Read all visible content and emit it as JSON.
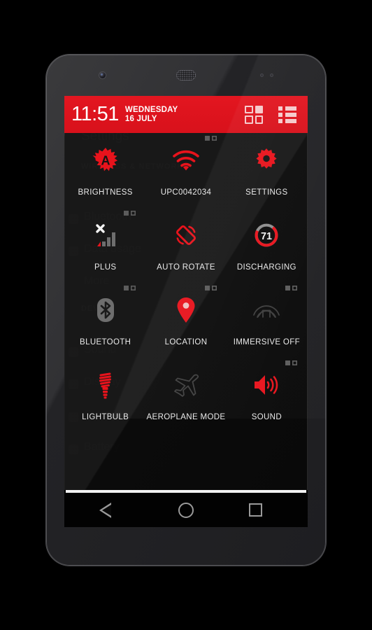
{
  "device": {
    "front_camera": "camera-icon",
    "earpiece": "speaker-grille-icon"
  },
  "header": {
    "time": "11:51",
    "day_of_week": "WEDNESDAY",
    "date": "16 JULY",
    "accent_color": "#e1131d",
    "grid_view_label": "grid-view",
    "list_view_label": "list-view"
  },
  "background_settings": {
    "title": "Settings",
    "sections": [
      {
        "label": "WIRELESS & NETWORKS",
        "items": [
          "Bluetooth",
          "Data usage",
          "More"
        ]
      },
      {
        "label": "DEVICE",
        "items": [
          "Sound",
          "Display",
          "Storage",
          "Battery"
        ]
      }
    ]
  },
  "tiles": [
    {
      "label": "BRIGHTNESS",
      "icon": "brightness-auto-icon",
      "indicators": 0,
      "state_color": "#e8131c"
    },
    {
      "label": "UPC0042034",
      "icon": "wifi-icon",
      "indicators": 2,
      "state_color": "#e8131c"
    },
    {
      "label": "SETTINGS",
      "icon": "gear-icon",
      "indicators": 0,
      "state_color": "#e8131c"
    },
    {
      "label": "PLUS",
      "icon": "signal-off-icon",
      "indicators": 2,
      "state_color": "#8d8d8d"
    },
    {
      "label": "AUTO ROTATE",
      "icon": "auto-rotate-icon",
      "indicators": 0,
      "state_color": "#e8131c"
    },
    {
      "label": "DISCHARGING",
      "icon": "battery-ring-icon",
      "indicators": 0,
      "state_color": "#e8131c",
      "value": "71"
    },
    {
      "label": "BLUETOOTH",
      "icon": "bluetooth-icon",
      "indicators": 2,
      "state_color": "#6e6e6e"
    },
    {
      "label": "LOCATION",
      "icon": "location-pin-icon",
      "indicators": 2,
      "state_color": "#e8131c"
    },
    {
      "label": "IMMERSIVE OFF",
      "icon": "immersive-off-icon",
      "indicators": 2,
      "state_color": "#3a3a3a"
    },
    {
      "label": "LIGHTBULB",
      "icon": "lightbulb-icon",
      "indicators": 0,
      "state_color": "#e8131c"
    },
    {
      "label": "AEROPLANE MODE",
      "icon": "aeroplane-icon",
      "indicators": 0,
      "state_color": "#3a3a3a"
    },
    {
      "label": "SOUND",
      "icon": "volume-on-icon",
      "indicators": 2,
      "state_color": "#e8131c"
    }
  ],
  "navbar": {
    "back": "back-button",
    "home": "home-button",
    "recents": "recents-button"
  }
}
